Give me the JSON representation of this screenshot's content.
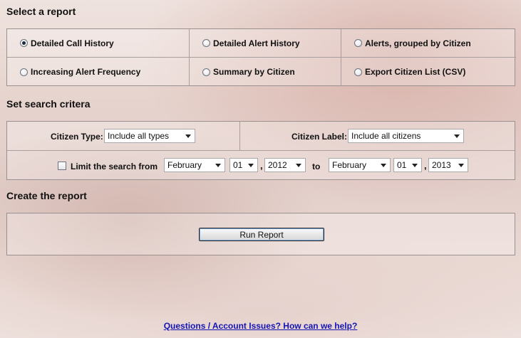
{
  "sections": {
    "select_report": "Select a report",
    "search_criteria": "Set search critera",
    "create_report": "Create the report"
  },
  "report_options": [
    {
      "label": "Detailed Call History",
      "checked": true
    },
    {
      "label": "Detailed Alert History",
      "checked": false
    },
    {
      "label": "Alerts, grouped by Citizen",
      "checked": false
    },
    {
      "label": "Increasing Alert Frequency",
      "checked": false
    },
    {
      "label": "Summary by Citizen",
      "checked": false
    },
    {
      "label": "Export Citizen List (CSV)",
      "checked": false
    }
  ],
  "criteria": {
    "citizen_type_label": "Citizen Type:",
    "citizen_type_value": "Include all types",
    "citizen_label_label": "Citizen Label:",
    "citizen_label_value": "Include all citizens",
    "limit_label": "Limit the search from",
    "limit_checked": false,
    "from_month": "February",
    "from_day": "01",
    "from_year": "2012",
    "to_label": "to",
    "to_month": "February",
    "to_day": "01",
    "to_year": "2013",
    "comma": ","
  },
  "run_button": "Run Report",
  "help_link": "Questions / Account Issues?  How can we help?"
}
